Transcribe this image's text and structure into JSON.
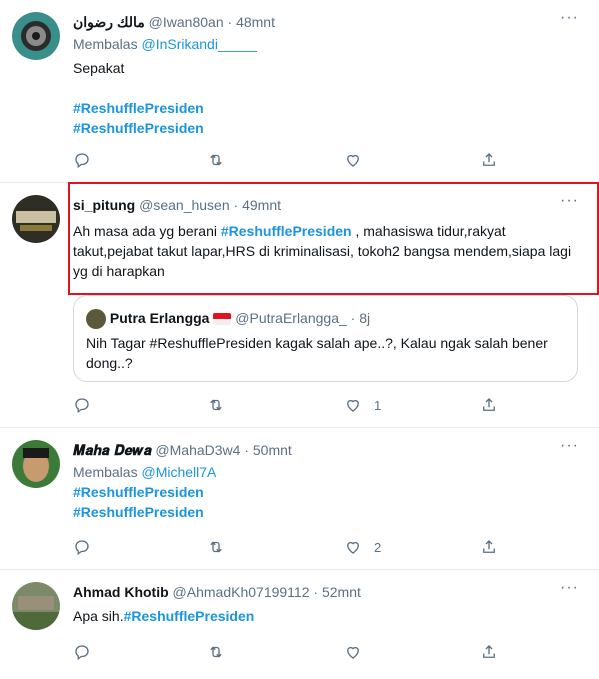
{
  "tweets": [
    {
      "name": "مالك رضوان",
      "handle": "@Iwan80an",
      "time": "48mnt",
      "reply_prefix": "Membalas",
      "reply_to": "@InSrikandi_____",
      "text": "Sepakat",
      "hashtags": [
        "#ReshufflePresiden",
        "#ReshufflePresiden"
      ],
      "likes": "",
      "avatar_color": "#3a8f8a"
    },
    {
      "name": "si_pitung",
      "handle": "@sean_husen",
      "time": "49mnt",
      "text_before": "Ah masa ada yg berani ",
      "hashtag_inline": "#ReshufflePresiden",
      "text_after": " , mahasiswa tidur,rakyat takut,pejabat takut lapar,HRS di kriminalisasi, tokoh2 bangsa mendem,siapa lagi yg di harapkan",
      "quote": {
        "name": "Putra Erlangga",
        "handle": "@PutraErlangga_",
        "time": "8j",
        "text": "Nih Tagar #ReshufflePresiden kagak salah ape..?, Kalau ngak salah bener dong..?"
      },
      "likes": "1",
      "avatar_color": "#4a4a3a"
    },
    {
      "name": "𝑴𝒂𝒉𝒂 𝑫𝒆𝒘𝒂",
      "handle": "@MahaD3w4",
      "time": "50mnt",
      "reply_prefix": "Membalas",
      "reply_to": "@Michell7A",
      "hashtags": [
        "#ReshufflePresiden",
        "#ReshufflePresiden"
      ],
      "likes": "2",
      "avatar_color": "#3c7a3a"
    },
    {
      "name": "Ahmad Khotib",
      "handle": "@AhmadKh07199112",
      "time": "52mnt",
      "text_before": "Apa sih.",
      "hashtag_inline": "#ReshufflePresiden",
      "avatar_color": "#6b7a55"
    }
  ],
  "separator": "·",
  "more_glyph": "···",
  "colors": {
    "accent": "#1b95e0",
    "highlight": "#e0141e"
  }
}
